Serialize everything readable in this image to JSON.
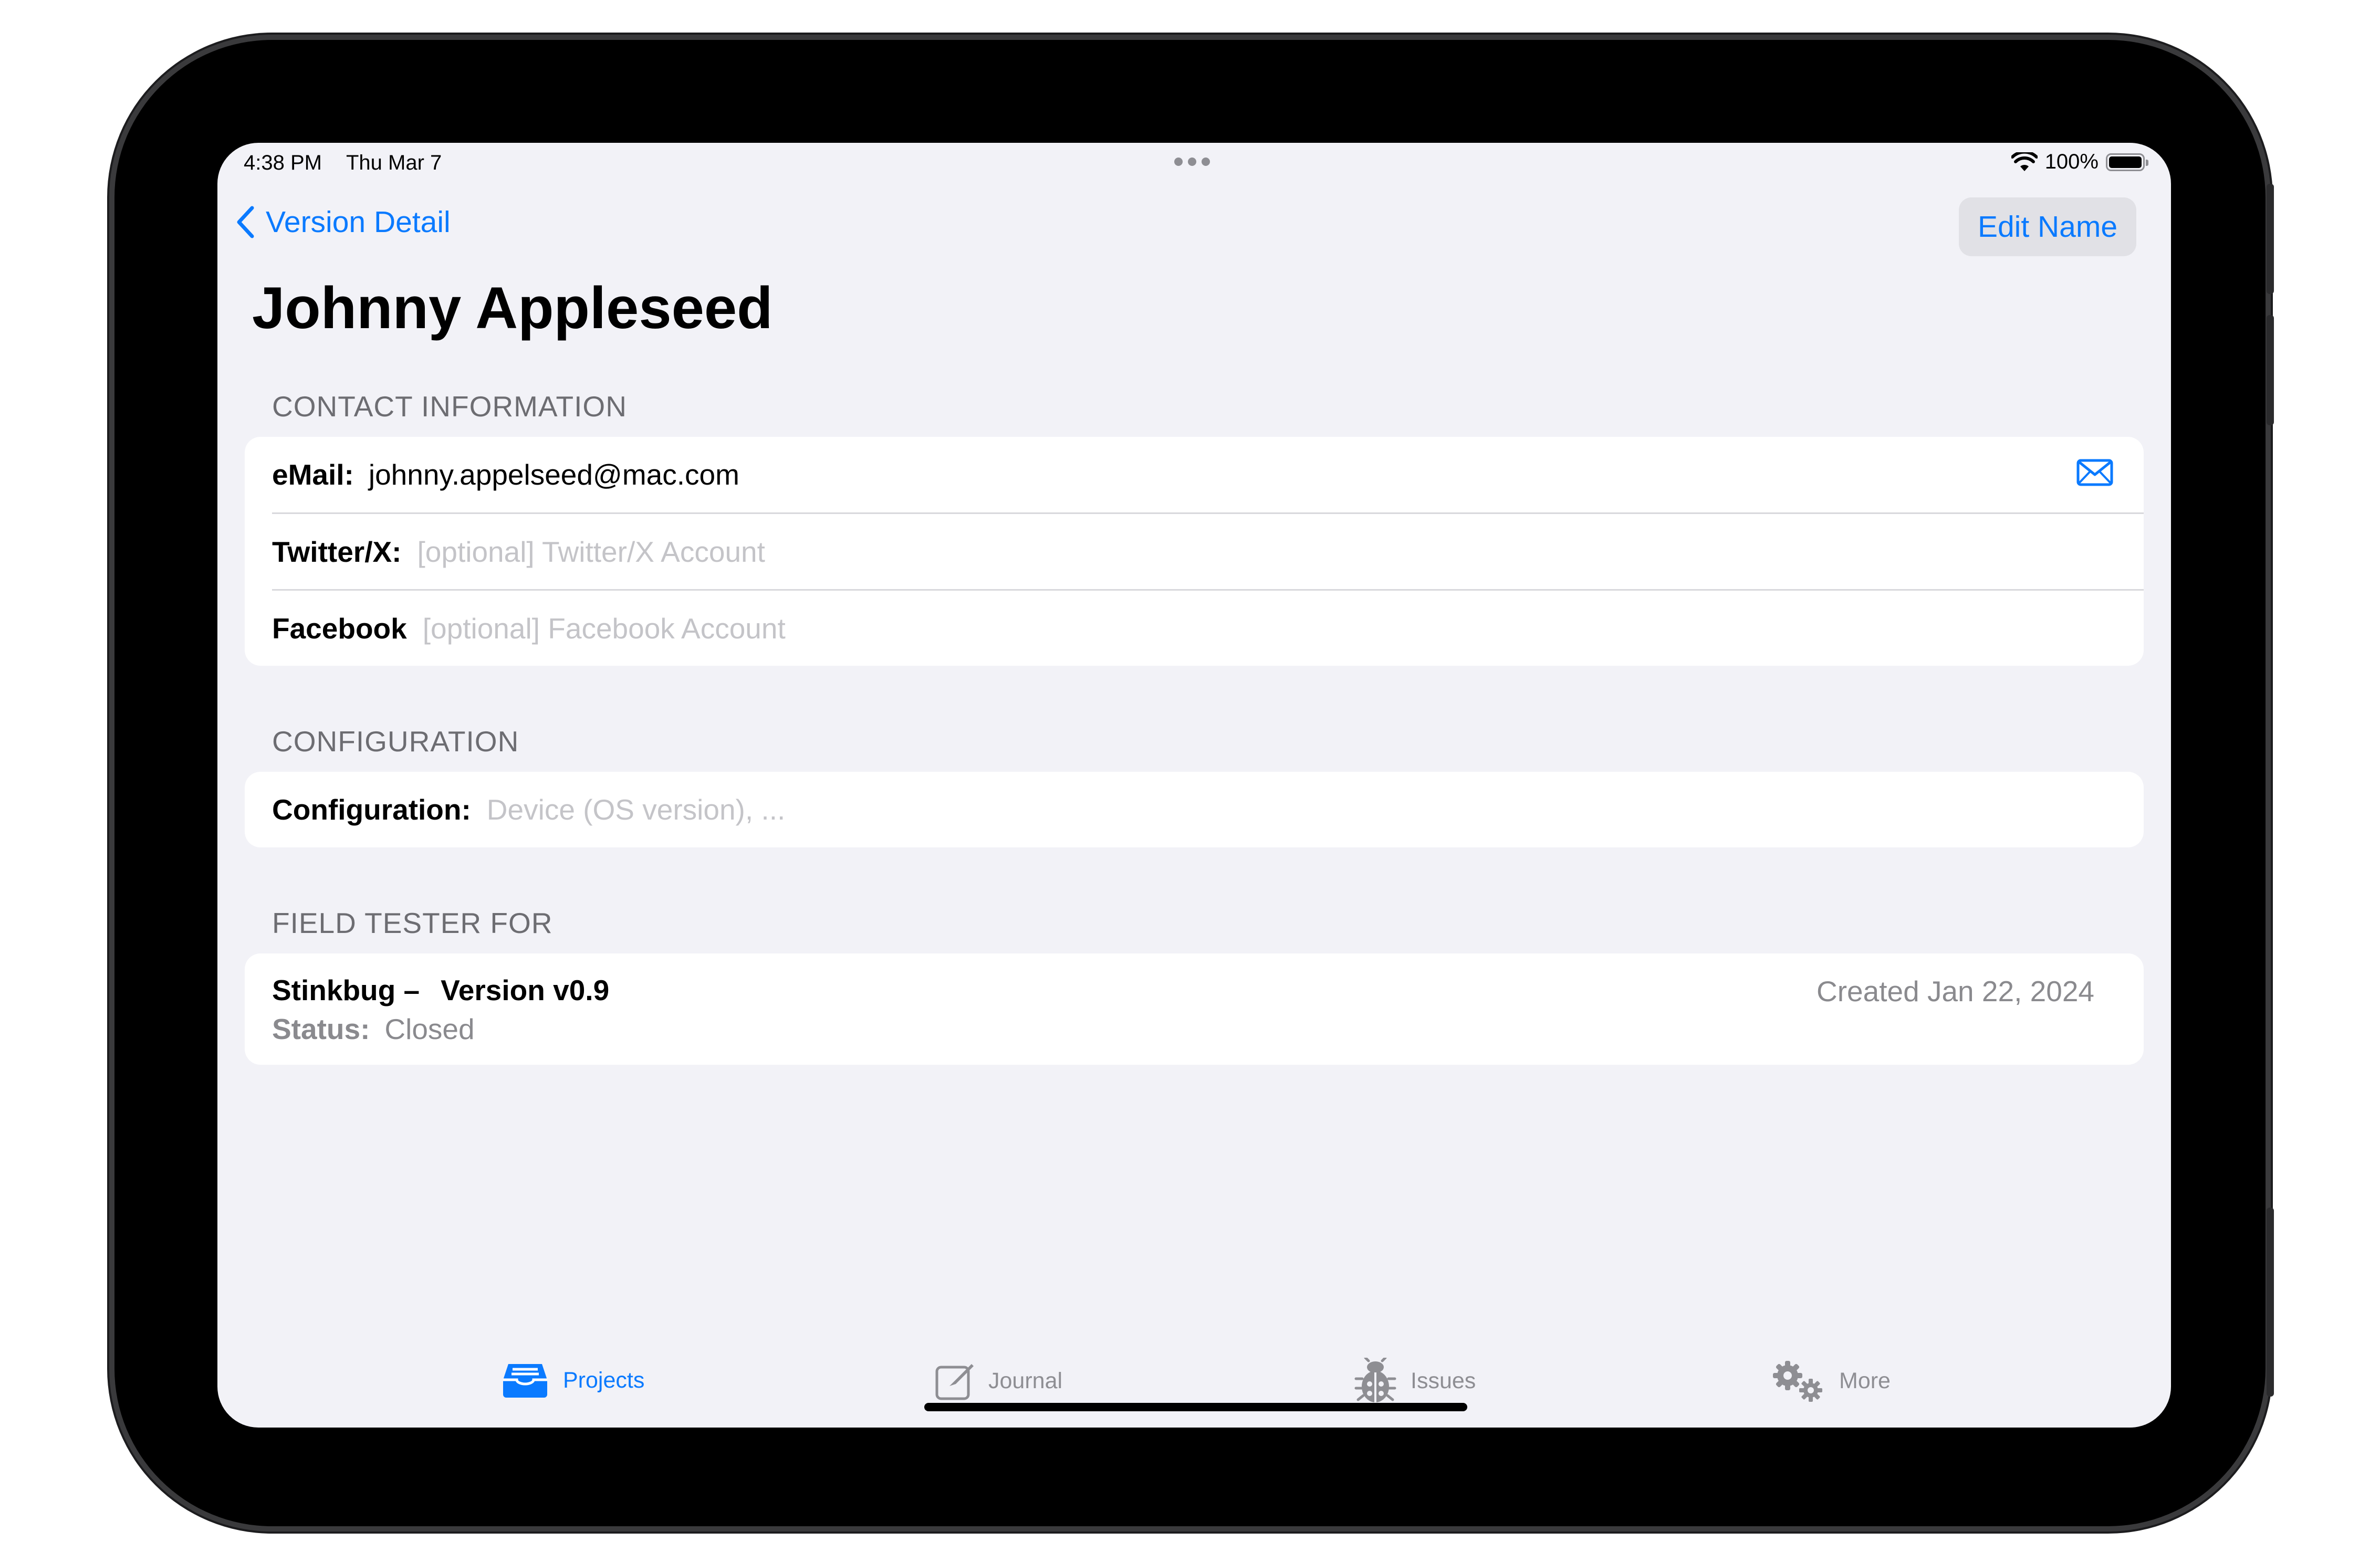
{
  "status_bar": {
    "time": "4:38 PM",
    "date": "Thu Mar 7",
    "battery": "100%"
  },
  "nav": {
    "back_label": "Version Detail",
    "edit_label": "Edit Name"
  },
  "page_title": "Johnny Appleseed",
  "sections": {
    "contact": {
      "header": "CONTACT INFORMATION",
      "email_label": "eMail:",
      "email_value": "johnny.appelseed@mac.com",
      "twitter_label": "Twitter/X:",
      "twitter_placeholder": "[optional] Twitter/X Account",
      "facebook_label": "Facebook",
      "facebook_placeholder": "[optional] Facebook Account"
    },
    "configuration": {
      "header": "CONFIGURATION",
      "label": "Configuration:",
      "placeholder": "Device (OS version), ..."
    },
    "field_tester": {
      "header": "FIELD TESTER FOR",
      "project": "Stinkbug –",
      "version": "Version v0.9",
      "status_label": "Status:",
      "status_value": "Closed",
      "created": "Created Jan 22, 2024"
    }
  },
  "tabs": [
    {
      "label": "Projects",
      "icon": "tray-icon",
      "active": true
    },
    {
      "label": "Journal",
      "icon": "compose-icon",
      "active": false
    },
    {
      "label": "Issues",
      "icon": "ladybug-icon",
      "active": false
    },
    {
      "label": "More",
      "icon": "gears-icon",
      "active": false
    }
  ],
  "colors": {
    "accent": "#0a7aff",
    "background": "#f2f2f7",
    "secondary": "#8e8e93"
  }
}
